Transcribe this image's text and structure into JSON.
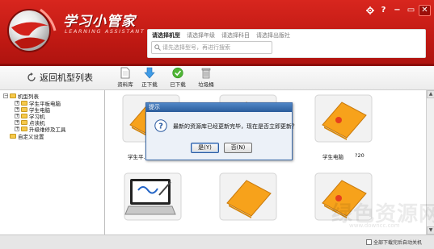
{
  "app": {
    "title": "学习小管家",
    "subtitle": "LEARNING ASSISTANT"
  },
  "window_controls": {
    "settings_icon": "gear-icon",
    "help_label": "?",
    "minimize_label": "−",
    "maximize_label": "▭",
    "close_label": "✕"
  },
  "search": {
    "tabs": [
      "请选择机型",
      "请选择年级",
      "请选择科目",
      "请选择出版社"
    ],
    "placeholder": "请先选择型号，再进行搜索"
  },
  "nav": {
    "back_label": "返回机型列表"
  },
  "toolbar": {
    "items": [
      {
        "label": "资料库",
        "icon": "document-icon"
      },
      {
        "label": "正下载",
        "icon": "download-arrow-icon"
      },
      {
        "label": "已下载",
        "icon": "checkmark-icon"
      },
      {
        "label": "垃圾桶",
        "icon": "trash-icon"
      }
    ]
  },
  "tree": {
    "root": "机型列表",
    "children": [
      "学生平板电脑",
      "学生电脑",
      "学习机",
      "点读机",
      "升级维修及工具"
    ],
    "custom": "自定义设置"
  },
  "products": [
    {
      "label": "学生平..."
    },
    {
      "label": ""
    },
    {
      "label": "学生电脑",
      "extra": "?20"
    },
    {
      "label": ""
    },
    {
      "label": ""
    },
    {
      "label": ""
    }
  ],
  "dialog": {
    "title": "提示",
    "message": "最新的资源库已经更新完毕，现在是否立即更新？",
    "yes_label": "是(Y)",
    "no_label": "否(N)"
  },
  "statusbar": {
    "auto_shutdown_label": "全部下载完后自动关机"
  },
  "watermark": {
    "text": "绿色资源网",
    "url": "www.downcc.com"
  },
  "colors": {
    "brand_red": "#c21a14",
    "dialog_title": "#2b5c9b",
    "folder_yellow": "#f6c94b",
    "laptop_orange": "#f7a21b"
  }
}
